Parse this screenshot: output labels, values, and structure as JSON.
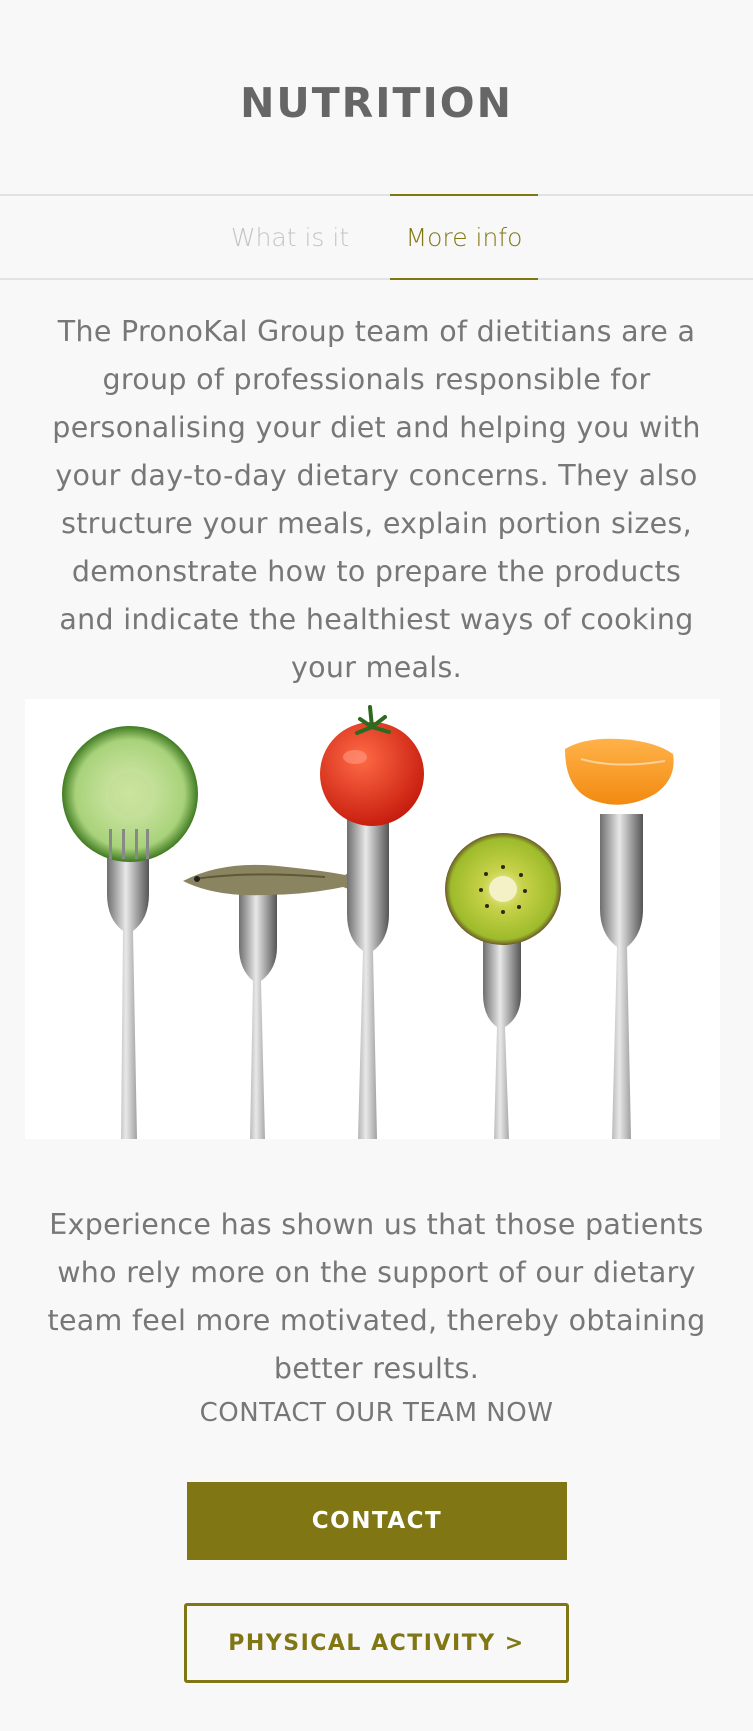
{
  "header": {
    "title": "NUTRITION"
  },
  "tabs": [
    {
      "label": "What is it",
      "active": false
    },
    {
      "label": "More info",
      "active": true
    }
  ],
  "content": {
    "intro": "The PronoKal Group team of dietitians are a group of professionals responsible for personalising your diet and helping you with your day-to-day dietary concerns. They also structure your meals, explain portion sizes, demonstrate how to prepare the products and indicate the healthiest ways of cooking your meals.",
    "outro": "Experience has shown us that those patients who rely more on the support of our dietary team feel more motivated, thereby obtaining better results.",
    "cta_text": "CONTACT OUR TEAM NOW"
  },
  "buttons": {
    "contact": "CONTACT",
    "physical_activity": "PHYSICAL ACTIVITY >"
  },
  "colors": {
    "accent": "#817614",
    "background": "#f8f8f8",
    "text": "#777777"
  }
}
